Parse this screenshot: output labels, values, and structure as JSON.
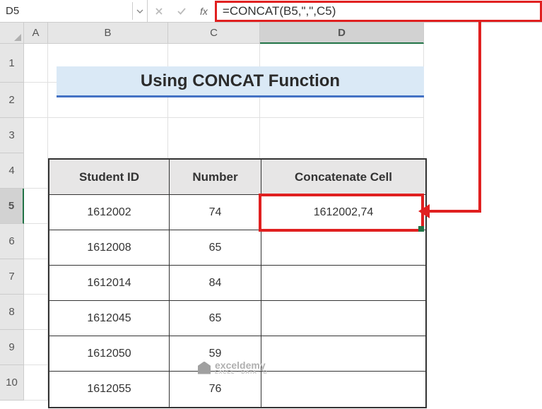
{
  "name_box": "D5",
  "formula": "=CONCAT(B5,\",\",C5)",
  "col_headers": [
    "A",
    "B",
    "C",
    "D"
  ],
  "row_headers": [
    "1",
    "2",
    "3",
    "4",
    "5",
    "6",
    "7",
    "8",
    "9",
    "10"
  ],
  "title": "Using CONCAT Function",
  "table": {
    "headers": [
      "Student ID",
      "Number",
      "Concatenate Cell"
    ],
    "rows": [
      {
        "id": "1612002",
        "num": "74",
        "concat": "1612002,74"
      },
      {
        "id": "1612008",
        "num": "65",
        "concat": ""
      },
      {
        "id": "1612014",
        "num": "84",
        "concat": ""
      },
      {
        "id": "1612045",
        "num": "65",
        "concat": ""
      },
      {
        "id": "1612050",
        "num": "59",
        "concat": ""
      },
      {
        "id": "1612055",
        "num": "76",
        "concat": ""
      }
    ]
  },
  "watermark": {
    "brand": "exceldemy",
    "sub": "EXCEL · DATA · B"
  },
  "chart_data": {
    "type": "table",
    "title": "Using CONCAT Function",
    "columns": [
      "Student ID",
      "Number",
      "Concatenate Cell"
    ],
    "rows": [
      [
        "1612002",
        74,
        "1612002,74"
      ],
      [
        "1612008",
        65,
        ""
      ],
      [
        "1612014",
        84,
        ""
      ],
      [
        "1612045",
        65,
        ""
      ],
      [
        "1612050",
        59,
        ""
      ],
      [
        "1612055",
        76,
        ""
      ]
    ],
    "formula_demonstrated": "=CONCAT(B5,\",\",C5)",
    "active_cell": "D5"
  }
}
